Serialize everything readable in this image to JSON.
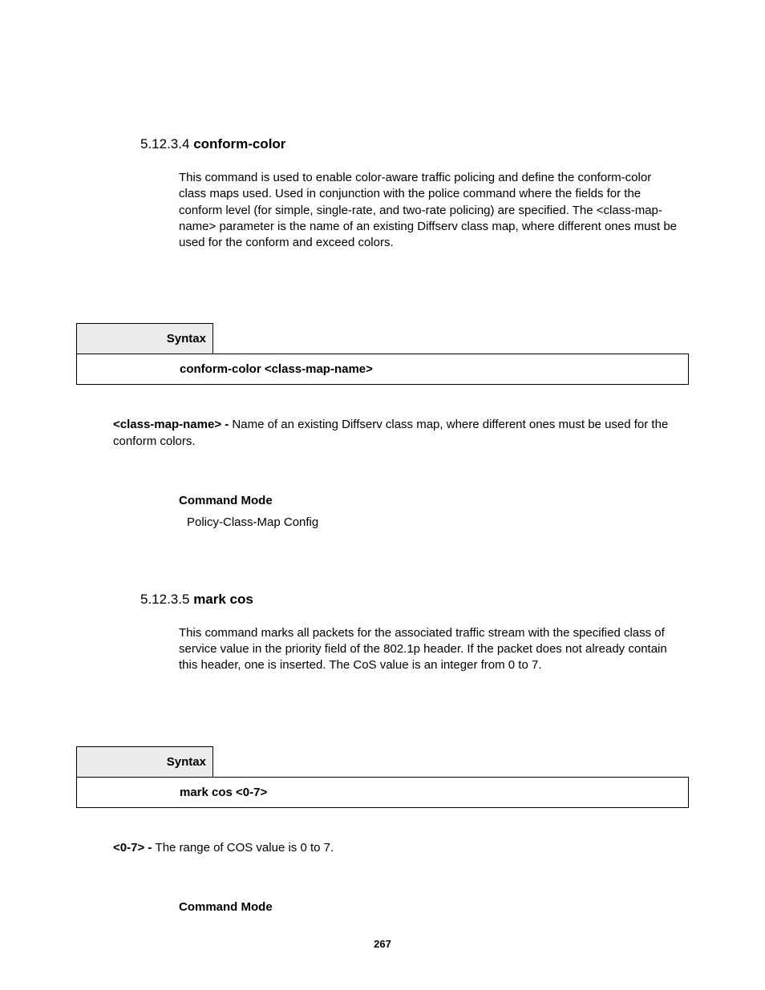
{
  "section1": {
    "num": "5.12.3.4",
    "title": "conform-color",
    "desc": "This command is used to enable color-aware traffic policing and define the conform-color class maps used. Used in conjunction with the police command where the fields for the conform level (for simple, single-rate, and two-rate policing) are specified. The <class-map-name> parameter is the name of an existing Diffserv class map, where different ones must be used for the conform and exceed colors.",
    "syntax_label": "Syntax",
    "syntax_cmd": "conform-color <class-map-name>",
    "param_name": "<class-map-name> - ",
    "param_desc": "Name of an existing Diffserv class map, where different ones must be used for the conform colors.",
    "cmd_mode_label": "Command Mode",
    "cmd_mode_val": "Policy-Class-Map Config"
  },
  "section2": {
    "num": "5.12.3.5",
    "title": "mark cos",
    "desc": "This command marks all packets for the associated traffic stream with the specified class of service value in the priority field of the 802.1p header. If the packet does not already contain this header, one is inserted. The CoS value is an integer from 0 to 7.",
    "syntax_label": "Syntax",
    "syntax_cmd": "mark cos <0-7>",
    "param_name": "<0-7> - ",
    "param_desc": "The range of COS value is 0 to 7.",
    "cmd_mode_label": "Command Mode"
  },
  "page_number": "267"
}
